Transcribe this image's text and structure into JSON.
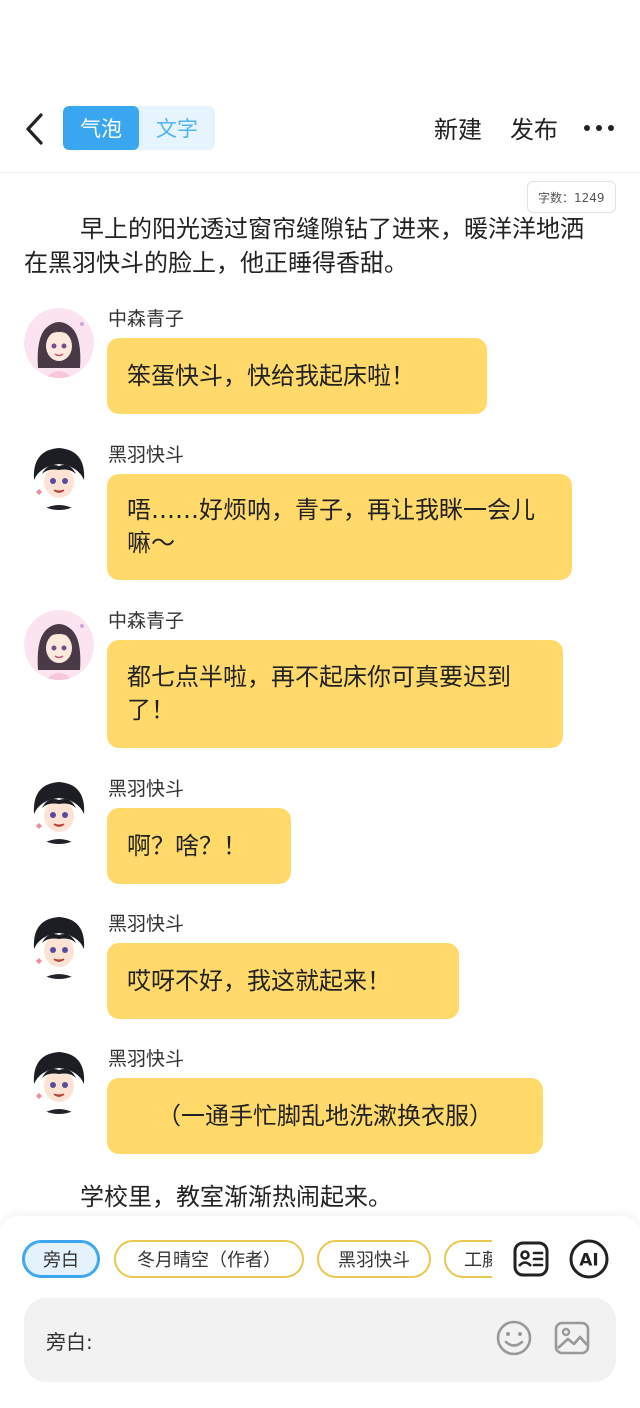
{
  "header": {
    "mode_bubble": "气泡",
    "mode_text": "文字",
    "new_label": "新建",
    "publish_label": "发布"
  },
  "word_count": "字数：1249",
  "narration": [
    "早上的阳光透过窗帘缝隙钻了进来，暖洋洋地洒在黑羽快斗的脸上，他正睡得香甜。",
    "学校里，教室渐渐热闹起来。"
  ],
  "messages": [
    {
      "speaker": "中森青子",
      "text": "笨蛋快斗，快给我起床啦！"
    },
    {
      "speaker": "黑羽快斗",
      "text": "唔……好烦呐，青子，再让我眯一会儿嘛～"
    },
    {
      "speaker": "中森青子",
      "text": "都七点半啦，再不起床你可真要迟到了！"
    },
    {
      "speaker": "黑羽快斗",
      "text": "啊？啥？！"
    },
    {
      "speaker": "黑羽快斗",
      "text": "哎呀不好，我这就起来！"
    },
    {
      "speaker": "黑羽快斗",
      "text": "（一通手忙脚乱地洗漱换衣服）"
    }
  ],
  "role_chips": [
    "旁白",
    "冬月晴空（作者）",
    "黑羽快斗",
    "工藤"
  ],
  "selected_role": "旁白",
  "ai_label": "AI",
  "input": {
    "prefix": "旁白:"
  },
  "colors": {
    "accent": "#3aa6ef",
    "bubble": "#ffd96a",
    "chip_border": "#e9c84f"
  },
  "icons": [
    "back-icon",
    "more-icon",
    "role-card-icon",
    "ai-icon",
    "emoji-icon",
    "image-icon"
  ]
}
